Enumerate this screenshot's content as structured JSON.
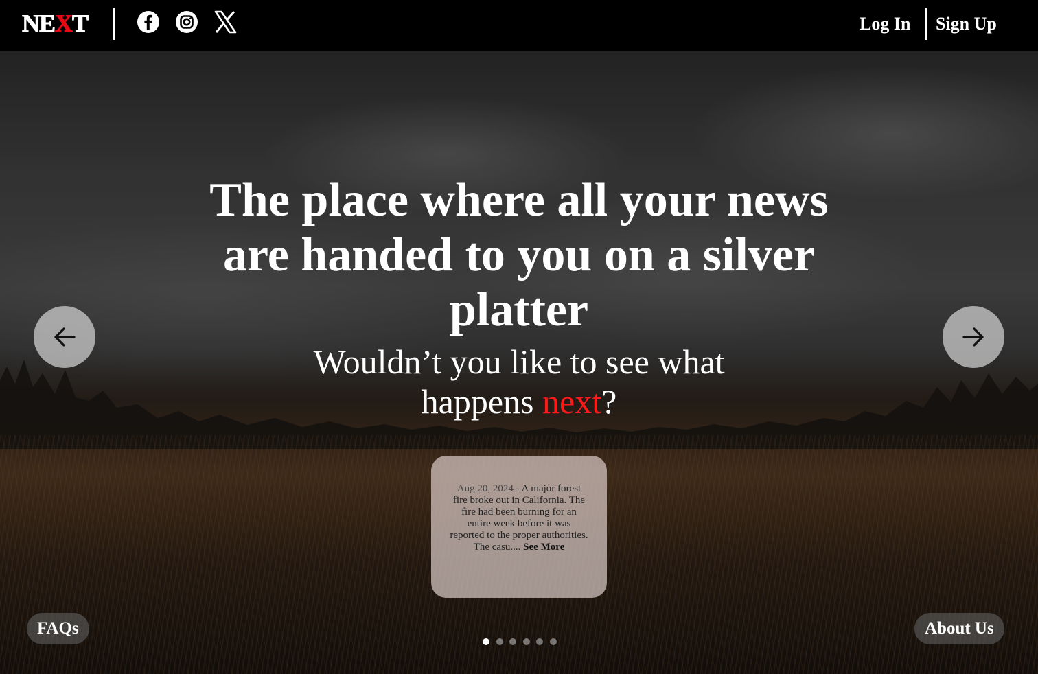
{
  "header": {
    "logo": {
      "prefix": "NE",
      "accent": "X",
      "suffix": "T"
    },
    "social": [
      {
        "name": "facebook-icon"
      },
      {
        "name": "instagram-icon"
      },
      {
        "name": "x-icon"
      }
    ],
    "login_label": "Log In",
    "signup_label": "Sign Up"
  },
  "hero": {
    "headline": "The place where all your news are handed to you on a silver platter",
    "subline_before": "Wouldn’t you like to see what happens ",
    "subline_accent": "next",
    "subline_after": "?",
    "accent_color": "#ff1a1a"
  },
  "news_card": {
    "date": "Aug 20, 2024",
    "separator": " - ",
    "excerpt": "A major forest fire broke out in California. The fire had been burning for an entire week before it was reported to the proper authorities. The casu.... ",
    "see_more_label": "See More"
  },
  "carousel": {
    "slide_count": 6,
    "active_index": 0
  },
  "footer": {
    "faqs_label": "FAQs",
    "about_label": "About Us"
  },
  "icons": {
    "prev": "arrow-left-icon",
    "next": "arrow-right-icon"
  }
}
